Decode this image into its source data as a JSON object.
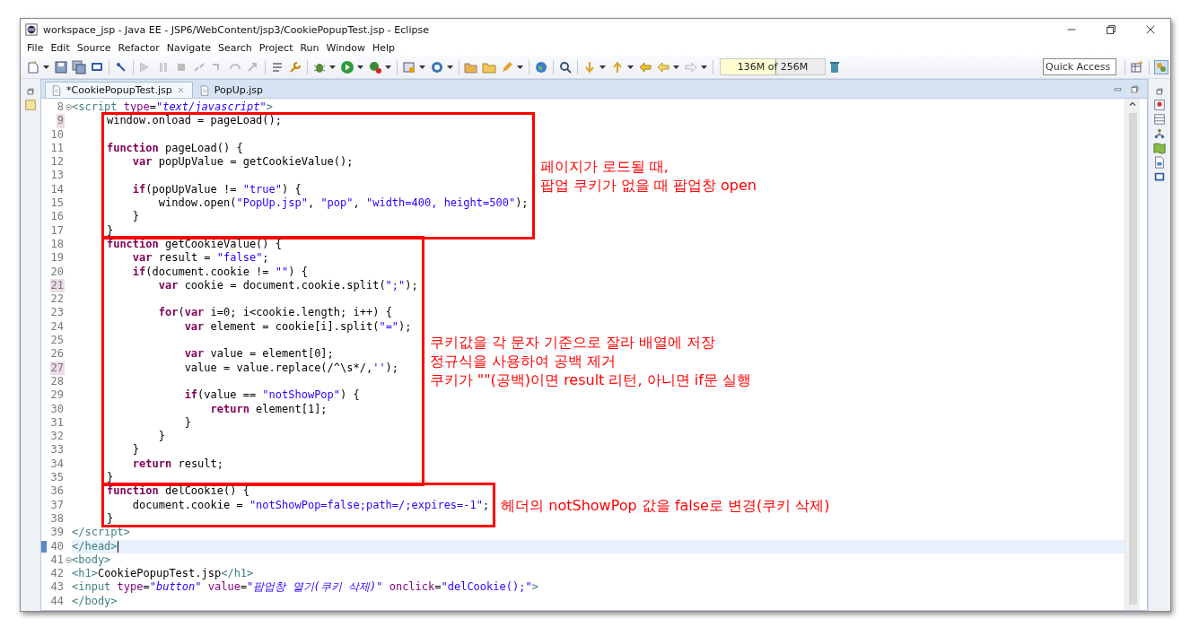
{
  "window": {
    "title": "workspace_jsp - Java EE - JSP6/WebContent/jsp3/CookiePopupTest.jsp - Eclipse"
  },
  "menu": [
    "File",
    "Edit",
    "Source",
    "Refactor",
    "Navigate",
    "Search",
    "Project",
    "Run",
    "Window",
    "Help"
  ],
  "toolbar": {
    "memory": {
      "text": "136M of 256M",
      "level": 0.53
    },
    "quick_access": {
      "placeholder": "Quick Access"
    }
  },
  "tabs": [
    {
      "label": "*CookiePopupTest.jsp",
      "selected": true
    },
    {
      "label": "PopUp.jsp",
      "selected": false
    }
  ],
  "editor": {
    "blocks": [
      {
        "lines": [
          {
            "number": "8",
            "fold": true,
            "tokens": [
              {
                "kind": "tag",
                "text": "<script"
              },
              {
                "kind": "attr",
                "text": " type"
              },
              {
                "kind": "text",
                "text": "="
              },
              {
                "kind": "attr_value",
                "text": "\"text/javascript\""
              },
              {
                "kind": "tag",
                "text": ">"
              }
            ]
          }
        ]
      },
      {
        "boxed": true,
        "note": [
          "페이지가 로드될 때,",
          "팝업 쿠키가 없을 때 팝업창 open"
        ],
        "lines": [
          {
            "number": "9",
            "marked": true,
            "tokens": [
              {
                "kind": "text",
                "text": "    window.onload = pageLoad();"
              }
            ]
          },
          {
            "number": "10"
          },
          {
            "number": "11",
            "tokens": [
              {
                "kind": "keyword",
                "text": "    function"
              },
              {
                "kind": "text",
                "text": " pageLoad() {"
              }
            ]
          },
          {
            "number": "12",
            "tokens": [
              {
                "kind": "keyword",
                "text": "        var"
              },
              {
                "kind": "text",
                "text": " popUpValue = getCookieValue();"
              }
            ]
          },
          {
            "number": "13"
          },
          {
            "number": "14",
            "tokens": [
              {
                "kind": "keyword",
                "text": "        if"
              },
              {
                "kind": "text",
                "text": "(popUpValue != "
              },
              {
                "kind": "string",
                "text": "\"true\""
              },
              {
                "kind": "text",
                "text": ") {"
              }
            ]
          },
          {
            "number": "15",
            "tokens": [
              {
                "kind": "text",
                "text": "            window.open("
              },
              {
                "kind": "string",
                "text": "\"PopUp.jsp\""
              },
              {
                "kind": "text",
                "text": ", "
              },
              {
                "kind": "string",
                "text": "\"pop\""
              },
              {
                "kind": "text",
                "text": ", "
              },
              {
                "kind": "string",
                "text": "\"width=400, height=500\""
              },
              {
                "kind": "text",
                "text": ");"
              }
            ]
          },
          {
            "number": "16",
            "tokens": [
              {
                "kind": "text",
                "text": "        }"
              }
            ]
          },
          {
            "number": "17",
            "tokens": [
              {
                "kind": "text",
                "text": "    }"
              }
            ]
          }
        ]
      },
      {
        "boxed": true,
        "note": [
          "쿠키값을 각 문자 기준으로 잘라 배열에 저장",
          "정규식을 사용하여 공백 제거",
          "쿠키가 \"\"(공백)이면 result 리턴, 아니면 if문 실행"
        ],
        "lines": [
          {
            "number": "18",
            "tokens": [
              {
                "kind": "keyword",
                "text": "    function"
              },
              {
                "kind": "text",
                "text": " getCookieValue() {"
              }
            ]
          },
          {
            "number": "19",
            "tokens": [
              {
                "kind": "keyword",
                "text": "        var"
              },
              {
                "kind": "text",
                "text": " result = "
              },
              {
                "kind": "string",
                "text": "\"false\""
              },
              {
                "kind": "text",
                "text": ";"
              }
            ]
          },
          {
            "number": "20",
            "tokens": [
              {
                "kind": "keyword",
                "text": "        if"
              },
              {
                "kind": "text",
                "text": "(document.cookie != "
              },
              {
                "kind": "string",
                "text": "\"\""
              },
              {
                "kind": "text",
                "text": ") {"
              }
            ]
          },
          {
            "number": "21",
            "marked": true,
            "tokens": [
              {
                "kind": "keyword",
                "text": "            var"
              },
              {
                "kind": "text",
                "text": " cookie = document.cookie.split("
              },
              {
                "kind": "string",
                "text": "\";\""
              },
              {
                "kind": "text",
                "text": ");"
              }
            ]
          },
          {
            "number": "22"
          },
          {
            "number": "23",
            "tokens": [
              {
                "kind": "keyword",
                "text": "            for"
              },
              {
                "kind": "text",
                "text": "("
              },
              {
                "kind": "keyword",
                "text": "var"
              },
              {
                "kind": "text",
                "text": " i=0; i<cookie.length; i++) {"
              }
            ]
          },
          {
            "number": "24",
            "tokens": [
              {
                "kind": "keyword",
                "text": "                var"
              },
              {
                "kind": "text",
                "text": " element = cookie[i].split("
              },
              {
                "kind": "string",
                "text": "\"=\""
              },
              {
                "kind": "text",
                "text": ");"
              }
            ]
          },
          {
            "number": "25"
          },
          {
            "number": "26",
            "tokens": [
              {
                "kind": "keyword",
                "text": "                var"
              },
              {
                "kind": "text",
                "text": " value = element[0];"
              }
            ]
          },
          {
            "number": "27",
            "marked": true,
            "tokens": [
              {
                "kind": "text",
                "text": "                value = value.replace(/^\\s*/,"
              },
              {
                "kind": "string",
                "text": "''"
              },
              {
                "kind": "text",
                "text": ");"
              }
            ]
          },
          {
            "number": "28"
          },
          {
            "number": "29",
            "tokens": [
              {
                "kind": "keyword",
                "text": "                if"
              },
              {
                "kind": "text",
                "text": "(value == "
              },
              {
                "kind": "string",
                "text": "\"notShowPop\""
              },
              {
                "kind": "text",
                "text": ") {"
              }
            ]
          },
          {
            "number": "30",
            "tokens": [
              {
                "kind": "keyword",
                "text": "                    return"
              },
              {
                "kind": "text",
                "text": " element[1];"
              }
            ]
          },
          {
            "number": "31",
            "tokens": [
              {
                "kind": "text",
                "text": "                }"
              }
            ]
          },
          {
            "number": "32",
            "tokens": [
              {
                "kind": "text",
                "text": "            }"
              }
            ]
          },
          {
            "number": "33",
            "tokens": [
              {
                "kind": "text",
                "text": "        }"
              }
            ]
          },
          {
            "number": "34",
            "tokens": [
              {
                "kind": "keyword",
                "text": "        return"
              },
              {
                "kind": "text",
                "text": " result;"
              }
            ]
          },
          {
            "number": "35",
            "tokens": [
              {
                "kind": "text",
                "text": "    }"
              }
            ]
          }
        ]
      },
      {
        "boxed": true,
        "note": [
          "헤더의 notShowPop 값을 false로 변경(쿠키 삭제)"
        ],
        "lines": [
          {
            "number": "36",
            "tokens": [
              {
                "kind": "keyword",
                "text": "    function"
              },
              {
                "kind": "text",
                "text": " delCookie() {"
              }
            ]
          },
          {
            "number": "37",
            "tokens": [
              {
                "kind": "text",
                "text": "        document.cookie = "
              },
              {
                "kind": "string",
                "text": "\"notShowPop=false;path=/;expires=-1\""
              },
              {
                "kind": "text",
                "text": ";"
              }
            ]
          },
          {
            "number": "38",
            "tokens": [
              {
                "kind": "text",
                "text": "    }"
              }
            ]
          }
        ]
      },
      {
        "lines": [
          {
            "number": "39",
            "tokens": [
              {
                "kind": "tag",
                "text": "</script>"
              }
            ]
          },
          {
            "number": "40",
            "current": true,
            "tokens": [
              {
                "kind": "tag",
                "text": "</head>"
              }
            ]
          },
          {
            "number": "41",
            "fold": true,
            "tokens": [
              {
                "kind": "tag",
                "text": "<body>"
              }
            ]
          },
          {
            "number": "42",
            "tokens": [
              {
                "kind": "tag",
                "text": "<h1>"
              },
              {
                "kind": "text",
                "text": "CookiePopupTest.jsp"
              },
              {
                "kind": "tag",
                "text": "</h1>"
              }
            ]
          },
          {
            "number": "43",
            "tokens": [
              {
                "kind": "tag",
                "text": "<input"
              },
              {
                "kind": "attr",
                "text": " type"
              },
              {
                "kind": "text",
                "text": "="
              },
              {
                "kind": "attr_value",
                "text": "\"button\""
              },
              {
                "kind": "attr",
                "text": " value"
              },
              {
                "kind": "text",
                "text": "="
              },
              {
                "kind": "attr_value",
                "text": "\"팝업창 열기(쿠키 삭제)\""
              },
              {
                "kind": "attr",
                "text": " onclick"
              },
              {
                "kind": "text",
                "text": "="
              },
              {
                "kind": "string",
                "text": "\"delCookie();\""
              },
              {
                "kind": "tag",
                "text": ">"
              }
            ]
          },
          {
            "number": "44",
            "tokens": [
              {
                "kind": "tag",
                "text": "</body>"
              }
            ]
          }
        ]
      }
    ]
  }
}
